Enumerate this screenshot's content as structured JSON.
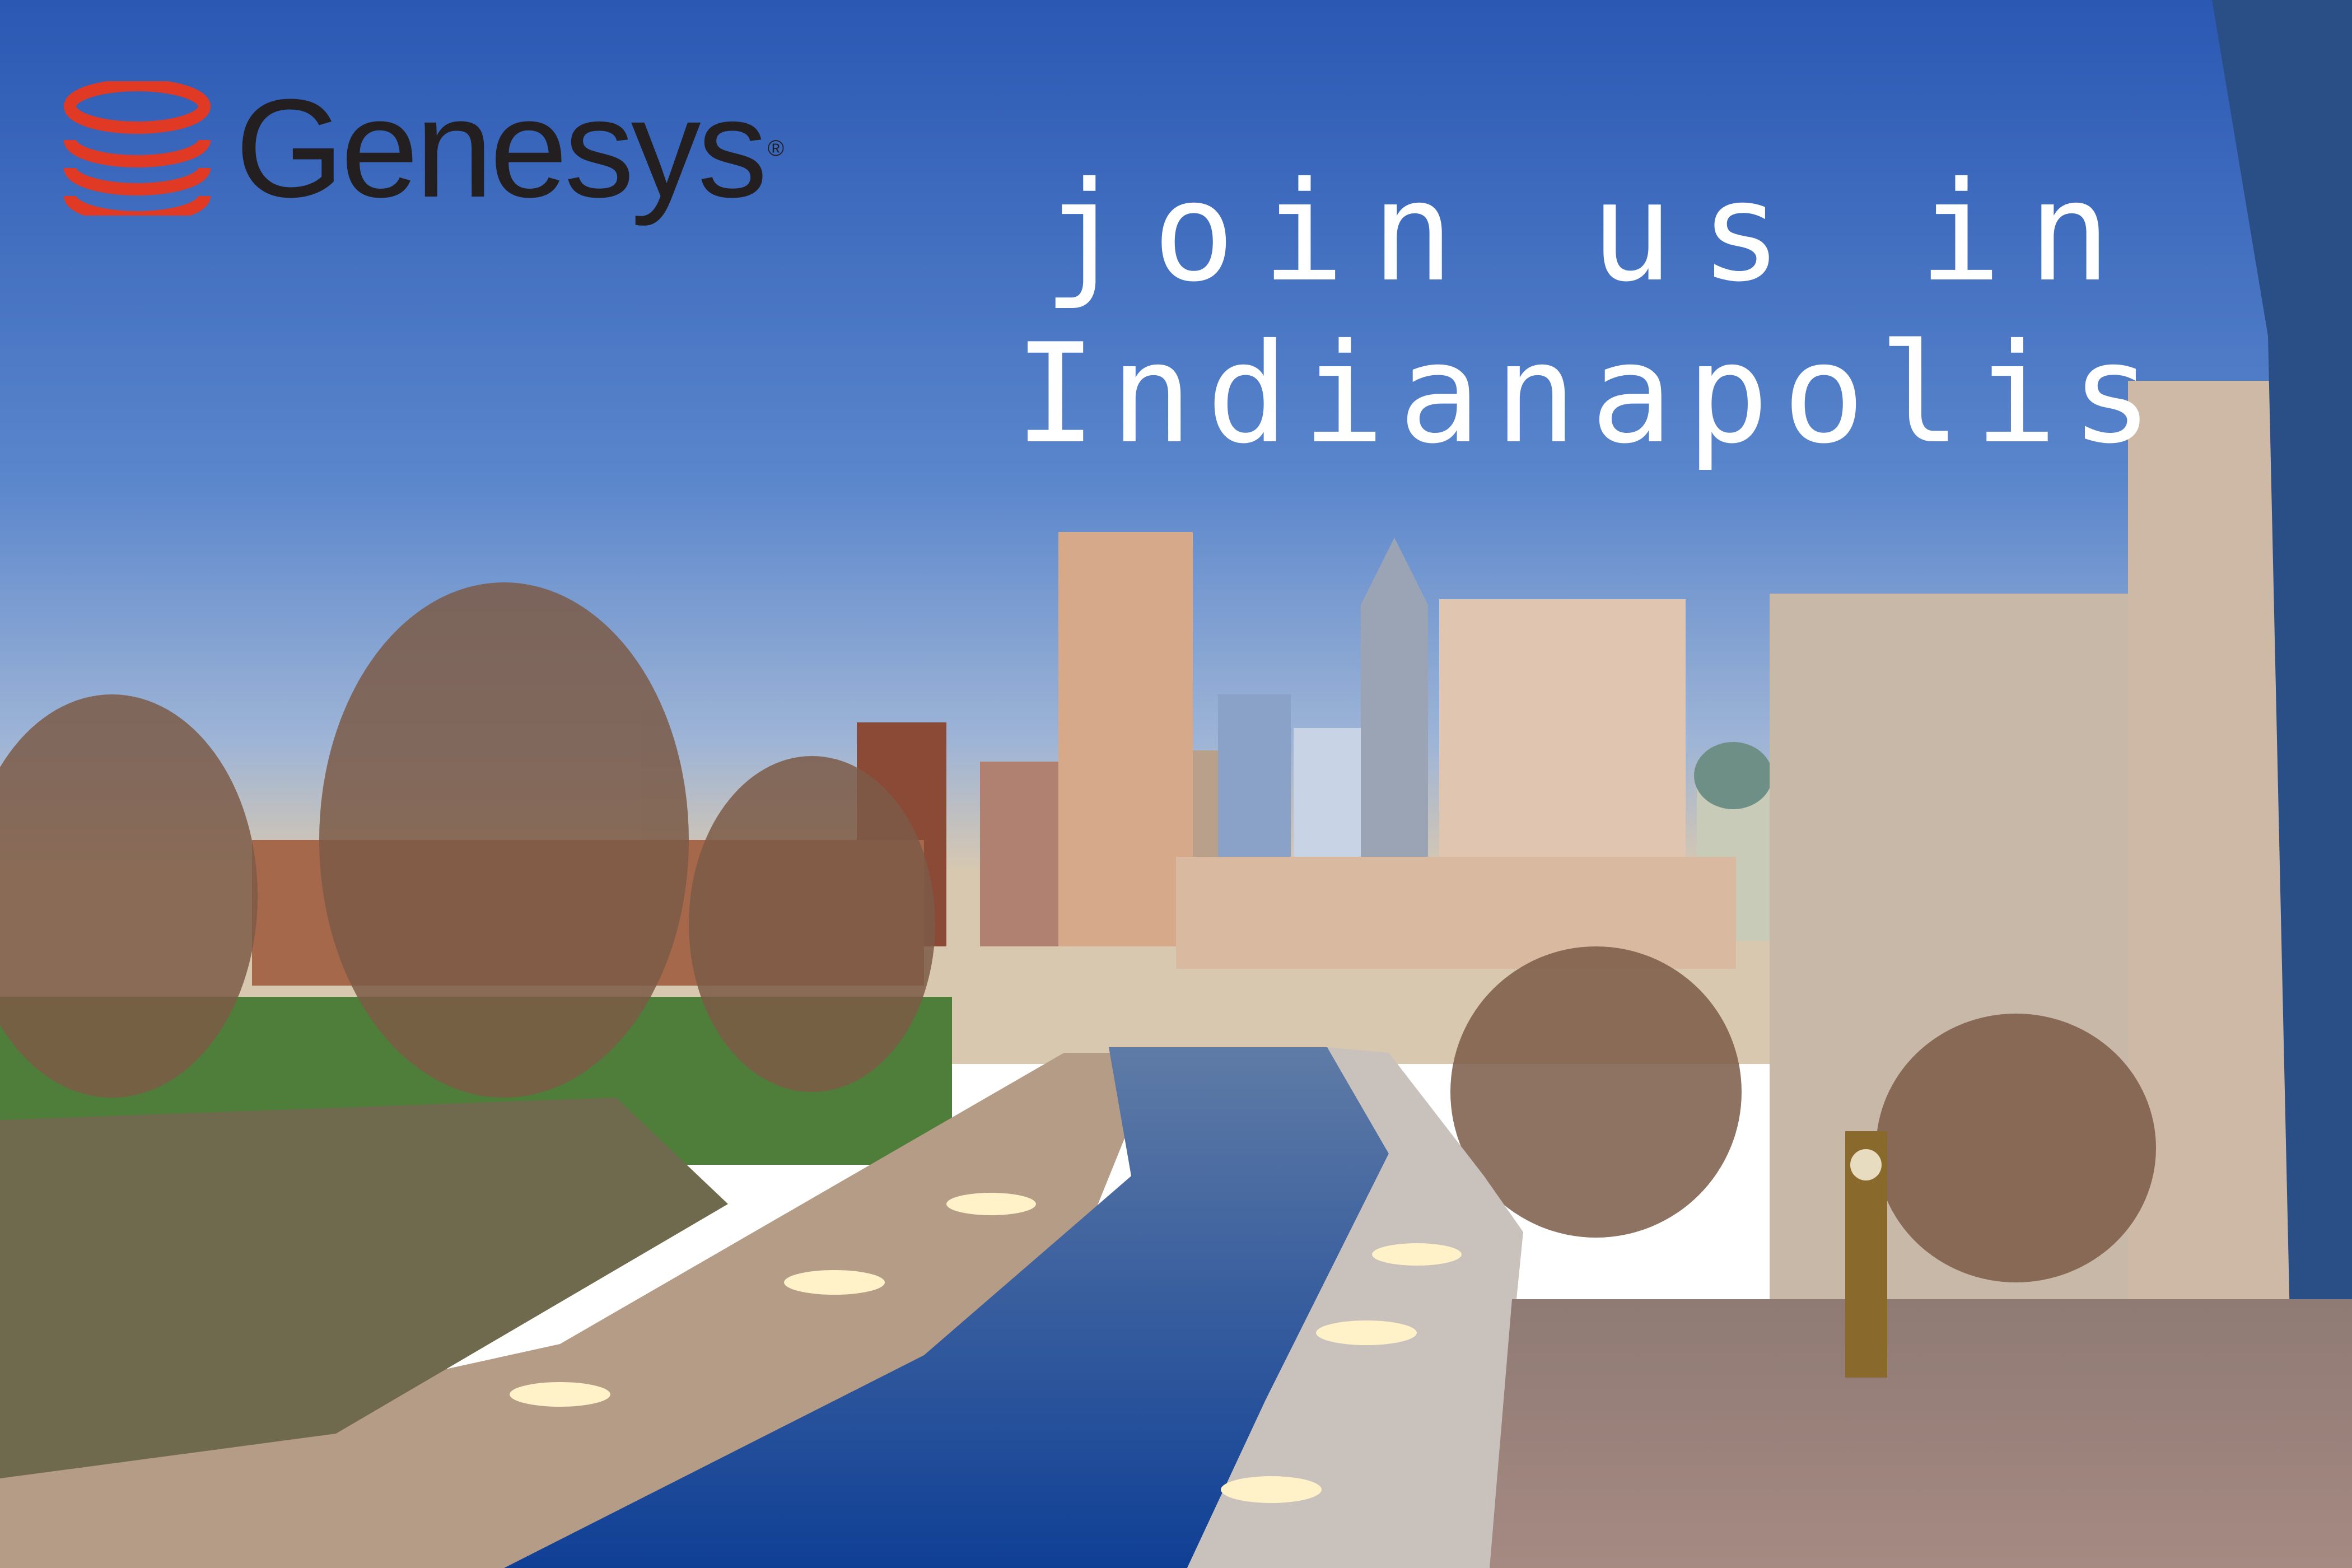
{
  "brand": {
    "name": "Genesys",
    "registered": "®"
  },
  "headline": {
    "line1": "join us in",
    "line2": "Indianapolis"
  },
  "colors": {
    "sky_top": "#2f5fb8",
    "water": "#1d56a8",
    "logo_red": "#e03a25",
    "text": "#ffffff"
  }
}
